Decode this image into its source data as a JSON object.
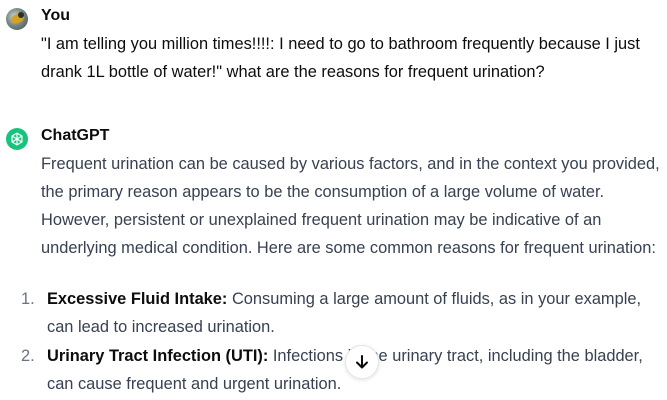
{
  "user_message": {
    "author": "You",
    "text": "\"I am telling you million times!!!!: I need to go to bathroom frequently because I just drank 1L bottle of water!\" what are the reasons for frequent urination?"
  },
  "assistant_message": {
    "author": "ChatGPT",
    "intro": "Frequent urination can be caused by various factors, and in the context you provided, the primary reason appears to be the consumption of a large volume of water. However, persistent or unexplained frequent urination may be indicative of an underlying medical condition. Here are some common reasons for frequent urination:",
    "list": [
      {
        "number": "1.",
        "title": "Excessive Fluid Intake:",
        "text": " Consuming a large amount of fluids, as in your example, can lead to increased urination."
      },
      {
        "number": "2.",
        "title": "Urinary Tract Infection (UTI):",
        "text": " Infections in the urinary tract, including the bladder, can cause frequent and urgent urination."
      }
    ]
  },
  "icons": {
    "user_avatar": "bird-avatar",
    "assistant_avatar": "openai-logo-icon",
    "scroll_button": "arrow-down-icon"
  },
  "colors": {
    "assistant_avatar_bg": "#19c37d",
    "text_primary": "#0d0d0d",
    "text_body": "#374151"
  }
}
